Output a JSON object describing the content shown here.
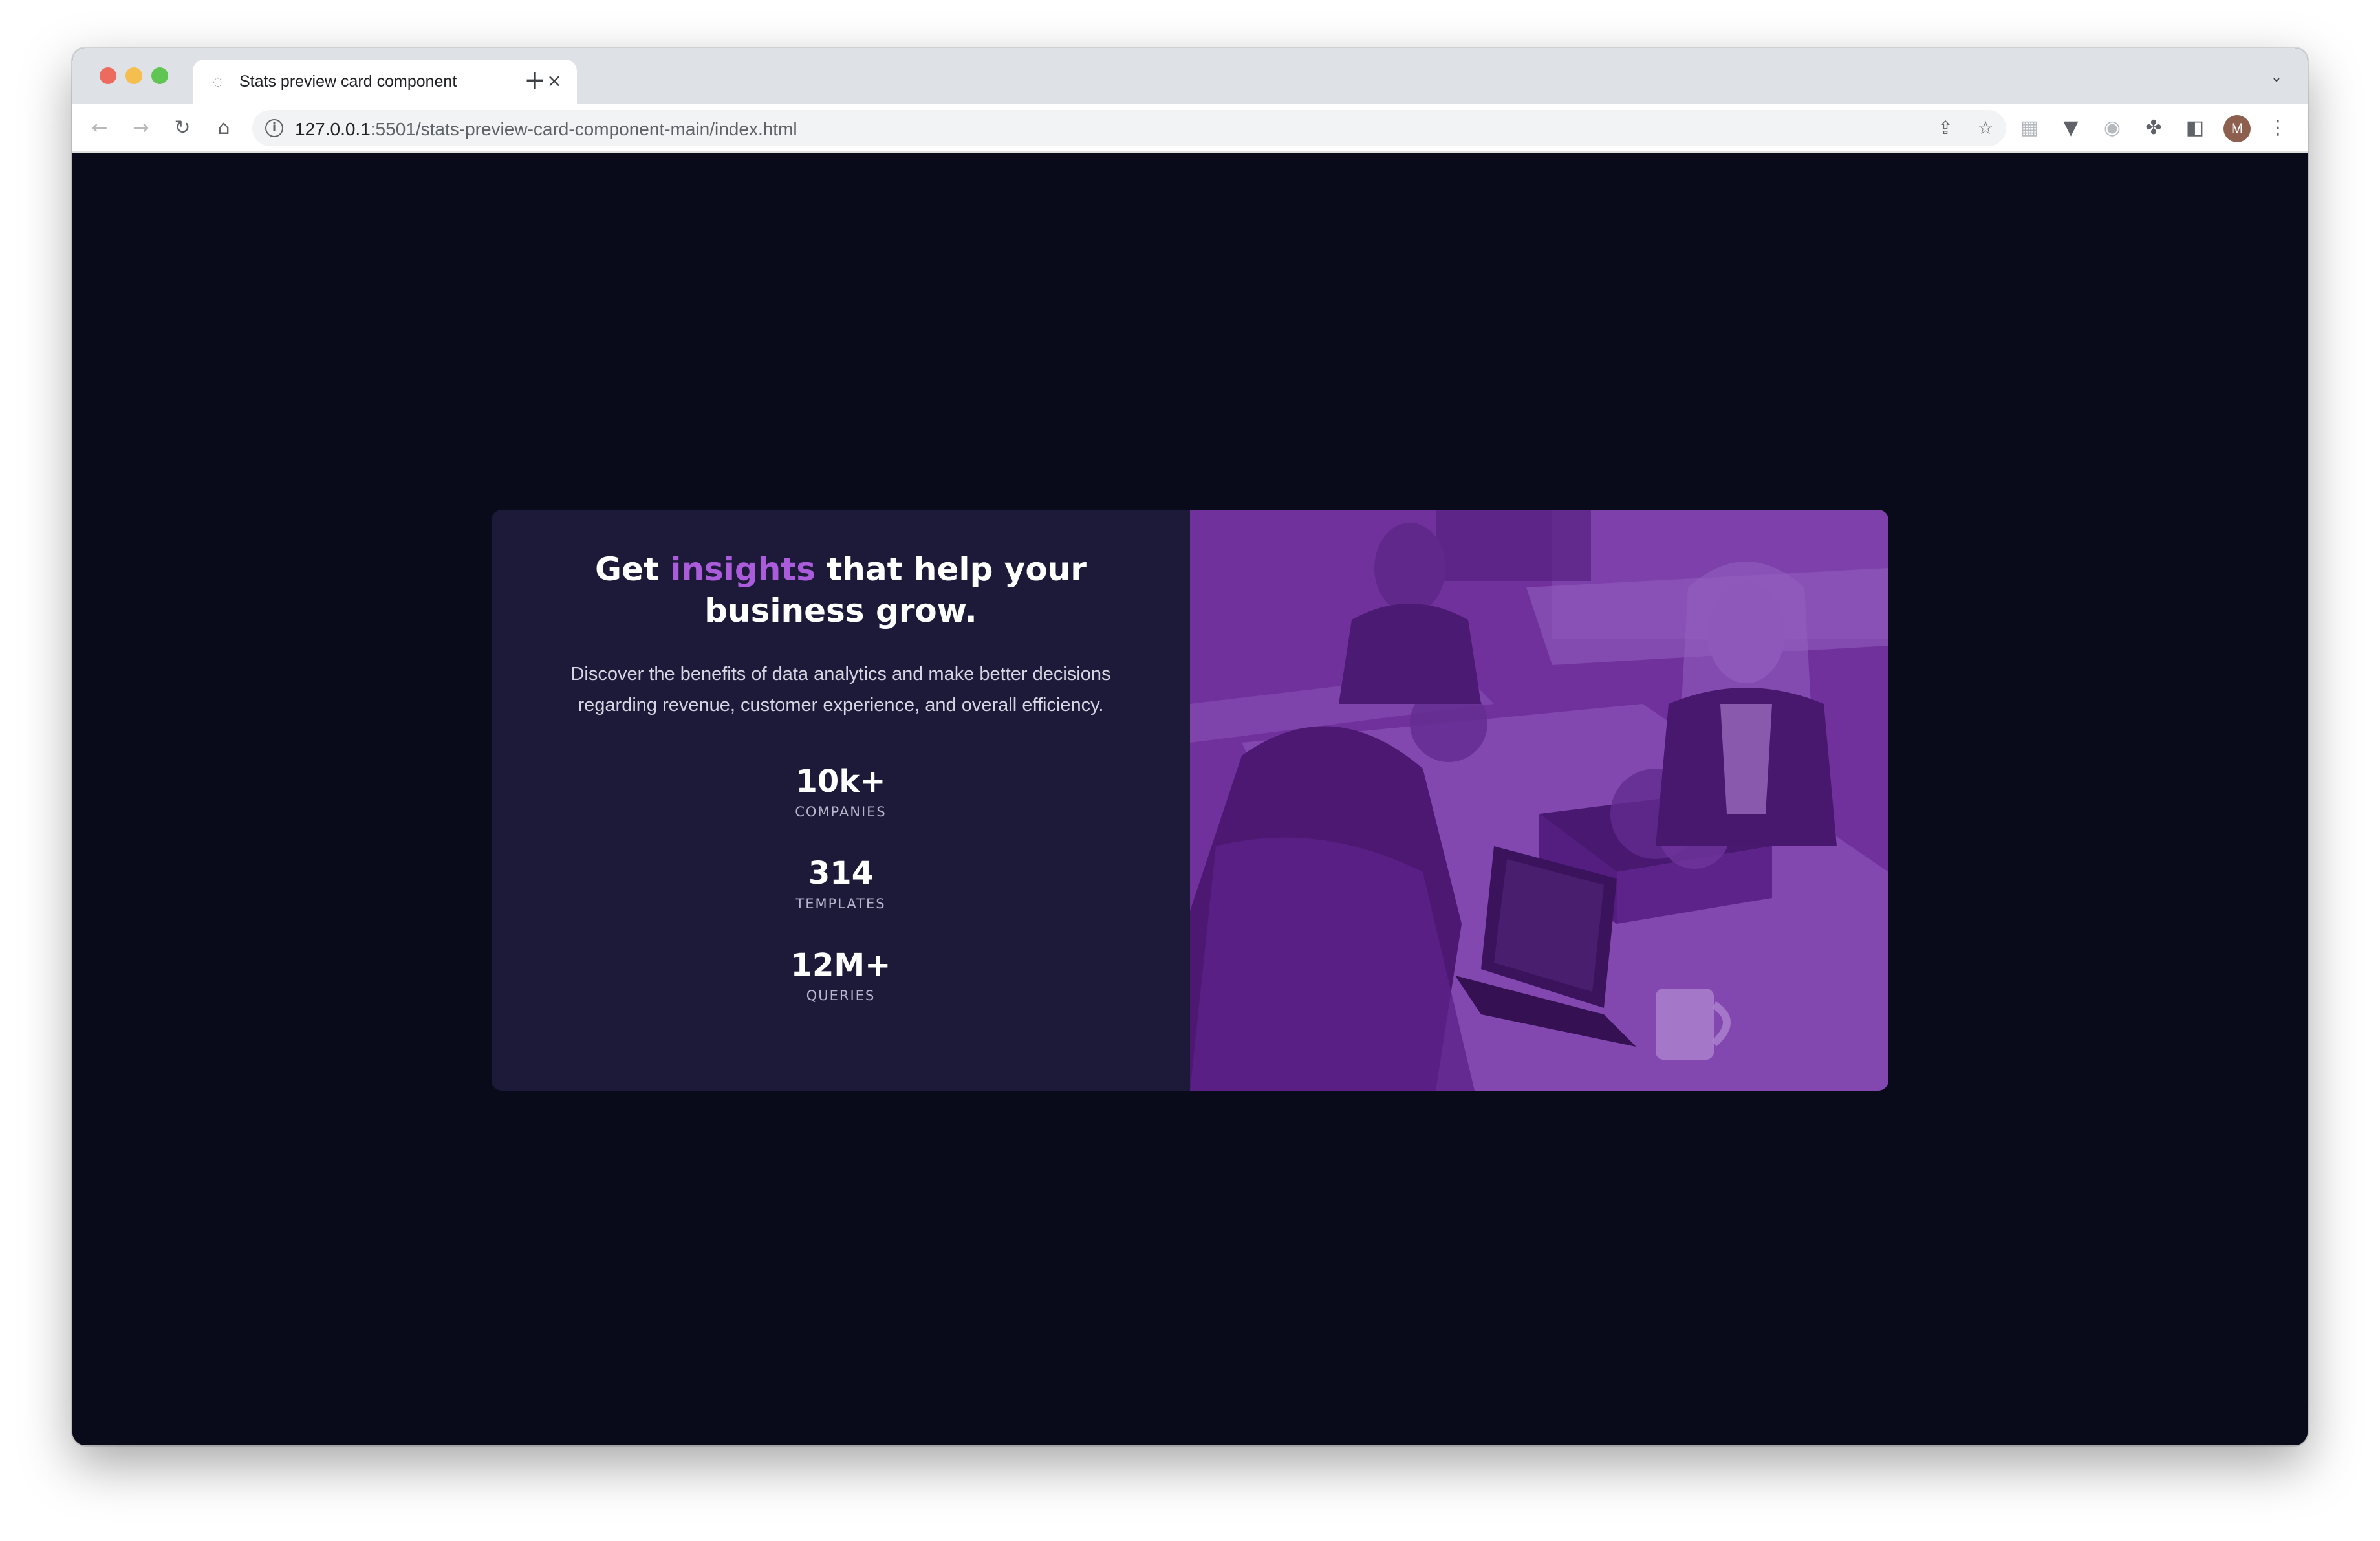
{
  "browser": {
    "tab_title": "Stats preview card component",
    "tab_favicon": "loading-favicon",
    "url_host": "127.0.0.1",
    "url_path": ":5501/stats-preview-card-component-main/index.html",
    "avatar_initial": "M"
  },
  "card": {
    "headline_before": "Get ",
    "headline_accent": "insights",
    "headline_after": " that help your business grow.",
    "description": "Discover the benefits of data analytics and make better decisions regarding revenue, customer experience, and overall efficiency.",
    "stats": [
      {
        "value": "10k+",
        "label": "COMPANIES"
      },
      {
        "value": "314",
        "label": "TEMPLATES"
      },
      {
        "value": "12M+",
        "label": "QUERIES"
      }
    ],
    "colors": {
      "page_bg": "#090b1a",
      "card_bg": "#1c1a38",
      "accent": "#aa5cdb",
      "image_overlay": "#6a2f96"
    }
  }
}
